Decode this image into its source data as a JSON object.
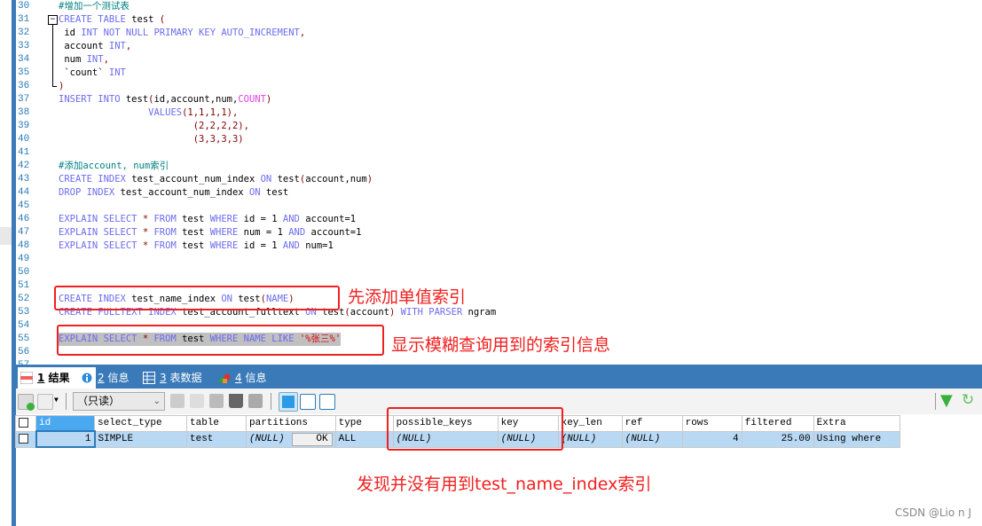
{
  "editor": {
    "lines": [
      {
        "no": "30",
        "tokens": [
          [
            "#增加一个测试表",
            "c"
          ]
        ]
      },
      {
        "no": "31",
        "tokens": [
          [
            "CREATE TABLE ",
            "k"
          ],
          [
            "test ",
            "t"
          ],
          [
            "(",
            "p"
          ]
        ]
      },
      {
        "no": "32",
        "tokens": [
          [
            " id ",
            "t"
          ],
          [
            "INT NOT NULL PRIMARY KEY AUTO_INCREMENT",
            "k"
          ],
          [
            ",",
            "p"
          ]
        ]
      },
      {
        "no": "33",
        "tokens": [
          [
            " account ",
            "t"
          ],
          [
            "INT",
            "k"
          ],
          [
            ",",
            "p"
          ]
        ]
      },
      {
        "no": "34",
        "tokens": [
          [
            " num ",
            "t"
          ],
          [
            "INT",
            "k"
          ],
          [
            ",",
            "p"
          ]
        ]
      },
      {
        "no": "35",
        "tokens": [
          [
            " `count` ",
            "t"
          ],
          [
            "INT",
            "k"
          ]
        ]
      },
      {
        "no": "36",
        "tokens": [
          [
            ")",
            "p"
          ]
        ]
      },
      {
        "no": "37",
        "tokens": [
          [
            "INSERT INTO ",
            "k"
          ],
          [
            "test",
            "t"
          ],
          [
            "(",
            "p"
          ],
          [
            "id,account,num,",
            "t"
          ],
          [
            "COUNT",
            "f"
          ],
          [
            ")",
            "p"
          ]
        ]
      },
      {
        "no": "38",
        "tokens": [
          [
            "                ",
            "t"
          ],
          [
            "VALUES",
            "k"
          ],
          [
            "(1,1,1,1),",
            "n"
          ]
        ]
      },
      {
        "no": "39",
        "tokens": [
          [
            "                        (2,2,2,2),",
            "n"
          ]
        ]
      },
      {
        "no": "40",
        "tokens": [
          [
            "                        (3,3,3,3)",
            "n"
          ]
        ]
      },
      {
        "no": "41",
        "tokens": []
      },
      {
        "no": "42",
        "tokens": [
          [
            "#添加account, num索引",
            "c"
          ]
        ]
      },
      {
        "no": "43",
        "tokens": [
          [
            "CREATE INDEX ",
            "k"
          ],
          [
            "test_account_num_index ",
            "t"
          ],
          [
            "ON ",
            "k"
          ],
          [
            "test",
            "t"
          ],
          [
            "(",
            "p"
          ],
          [
            "account,num",
            "t"
          ],
          [
            ")",
            "p"
          ]
        ]
      },
      {
        "no": "44",
        "tokens": [
          [
            "DROP INDEX ",
            "k"
          ],
          [
            "test_account_num_index ",
            "t"
          ],
          [
            "ON ",
            "k"
          ],
          [
            "test",
            "t"
          ]
        ]
      },
      {
        "no": "45",
        "tokens": []
      },
      {
        "no": "46",
        "tokens": [
          [
            "EXPLAIN SELECT ",
            "k"
          ],
          [
            "* ",
            "p"
          ],
          [
            "FROM ",
            "k"
          ],
          [
            "test ",
            "t"
          ],
          [
            "WHERE ",
            "k"
          ],
          [
            "id = 1 ",
            "t"
          ],
          [
            "AND ",
            "k"
          ],
          [
            "account=1",
            "t"
          ]
        ]
      },
      {
        "no": "47",
        "tokens": [
          [
            "EXPLAIN SELECT ",
            "k"
          ],
          [
            "* ",
            "p"
          ],
          [
            "FROM ",
            "k"
          ],
          [
            "test ",
            "t"
          ],
          [
            "WHERE ",
            "k"
          ],
          [
            "num = 1 ",
            "t"
          ],
          [
            "AND ",
            "k"
          ],
          [
            "account=1",
            "t"
          ]
        ]
      },
      {
        "no": "48",
        "tokens": [
          [
            "EXPLAIN SELECT ",
            "k"
          ],
          [
            "* ",
            "p"
          ],
          [
            "FROM ",
            "k"
          ],
          [
            "test ",
            "t"
          ],
          [
            "WHERE ",
            "k"
          ],
          [
            "id = 1 ",
            "t"
          ],
          [
            "AND ",
            "k"
          ],
          [
            "num=1",
            "t"
          ]
        ]
      },
      {
        "no": "49",
        "tokens": []
      },
      {
        "no": "50",
        "tokens": []
      },
      {
        "no": "51",
        "tokens": []
      },
      {
        "no": "52",
        "tokens": [
          [
            "CREATE INDEX ",
            "k"
          ],
          [
            "test_name_index ",
            "t"
          ],
          [
            "ON ",
            "k"
          ],
          [
            "test",
            "t"
          ],
          [
            "(",
            "p"
          ],
          [
            "NAME",
            "k"
          ],
          [
            ")",
            "p"
          ]
        ]
      },
      {
        "no": "53",
        "tokens": [
          [
            "CREATE FULLTEXT INDEX ",
            "k"
          ],
          [
            "test_account_fulltext ",
            "t"
          ],
          [
            "ON ",
            "k"
          ],
          [
            "test",
            "t"
          ],
          [
            "(",
            "p"
          ],
          [
            "account",
            "t"
          ],
          [
            ") ",
            "p"
          ],
          [
            "WITH PARSER ",
            "k"
          ],
          [
            "ngram",
            "t"
          ]
        ]
      },
      {
        "no": "54",
        "tokens": []
      },
      {
        "no": "55",
        "tokens": [
          [
            "EXPLAIN SELECT ",
            "k"
          ],
          [
            "* ",
            "p"
          ],
          [
            "FROM ",
            "k"
          ],
          [
            "test ",
            "t"
          ],
          [
            "WHERE ",
            "k"
          ],
          [
            "NAME LIKE ",
            "k"
          ],
          [
            "'%张三%'",
            "s"
          ]
        ],
        "highlight": true
      },
      {
        "no": "56",
        "tokens": []
      },
      {
        "no": "57",
        "tokens": []
      }
    ]
  },
  "annotations": {
    "single_index": "先添加单值索引",
    "fuzzy_query": "显示模糊查询用到的索引信息",
    "not_used": "发现并没有用到test_name_index索引"
  },
  "tabs": [
    {
      "num": "1",
      "label": "结果",
      "icon": "result-grid-icon",
      "active": true
    },
    {
      "num": "2",
      "label": "信息",
      "icon": "info-icon"
    },
    {
      "num": "3",
      "label": "表数据",
      "icon": "table-data-icon"
    },
    {
      "num": "4",
      "label": "信息",
      "icon": "shapes-info-icon"
    }
  ],
  "toolbar": {
    "readonly_select": "（只读）"
  },
  "grid": {
    "columns": [
      "id",
      "select_type",
      "table",
      "partitions",
      "type",
      "possible_keys",
      "key",
      "key_len",
      "ref",
      "rows",
      "filtered",
      "Extra"
    ],
    "rows": [
      [
        "1",
        "SIMPLE",
        "test",
        "(NULL)",
        "ALL",
        "(NULL)",
        "(NULL)",
        "(NULL)",
        "(NULL)",
        "4",
        "25.00",
        "Using where"
      ]
    ],
    "ok_label": "OK"
  },
  "colors": {
    "accent": "#3a7ab8",
    "annotation": "#f02020",
    "row_selected": "#b8d8f4"
  },
  "watermark": "CSDN @Lio n   J"
}
